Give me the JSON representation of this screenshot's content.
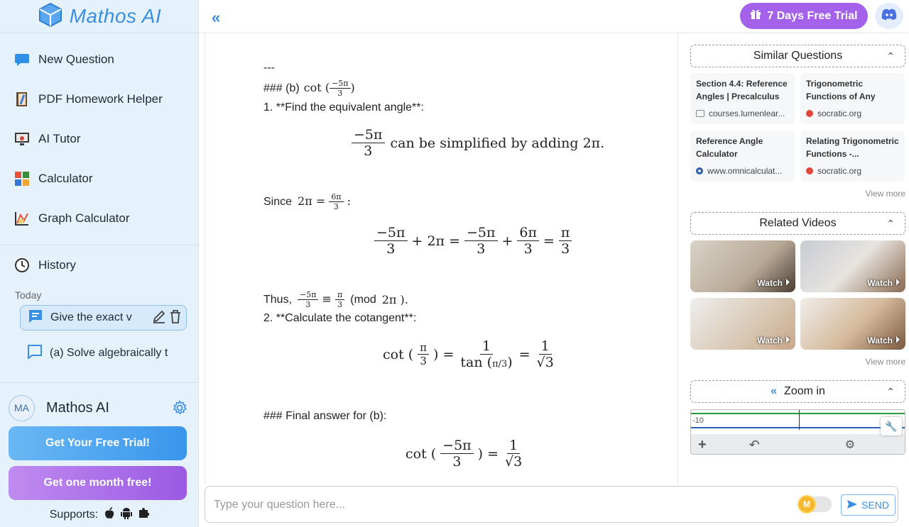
{
  "sidebar": {
    "logo": "Mathos AI",
    "nav": [
      {
        "label": "New Question",
        "icon": "chat-bubble-icon"
      },
      {
        "label": "PDF Homework Helper",
        "icon": "notebook-icon"
      },
      {
        "label": "AI Tutor",
        "icon": "tutor-icon"
      },
      {
        "label": "Calculator",
        "icon": "calculator-icon"
      },
      {
        "label": "Graph Calculator",
        "icon": "graph-icon"
      }
    ],
    "history_label": "History",
    "today_label": "Today",
    "history_items": [
      {
        "label": "Give the exact v"
      },
      {
        "label": "(a) Solve algebraically t"
      }
    ],
    "user": {
      "initials": "MA",
      "name": "Mathos AI"
    },
    "trial_button": "Get Your Free Trial!",
    "month_button": "Get one month free!",
    "supports_label": "Supports:"
  },
  "topbar": {
    "free_trial": "7 Days Free Trial"
  },
  "main": {
    "dashes": "---",
    "b_heading": "### (b)",
    "step1": "1. **Find the equivalent angle**:",
    "simplify_text": "can be simplified by adding 2π.",
    "since": "Since",
    "thus": "Thus,",
    "mod": "(mod",
    "mod_close": "2π ).",
    "step2": "2. **Calculate the cotangent**:",
    "final": "### Final answer for (b):"
  },
  "right": {
    "similar_title": "Similar Questions",
    "similar": [
      {
        "title": "Section 4.4: Reference Angles | Precalculus",
        "source": "courses.lumenlear..."
      },
      {
        "title": "Trigonometric Functions of Any Angl...",
        "source": "socratic.org"
      },
      {
        "title": "Reference Angle Calculator",
        "source": "www.omnicalculat..."
      },
      {
        "title": "Relating Trigonometric Functions -...",
        "source": "socratic.org"
      }
    ],
    "view_more": "View more",
    "videos_title": "Related Videos",
    "watch": "Watch",
    "zoom_title": "Zoom in",
    "graph_tick_label": "-10"
  },
  "input": {
    "placeholder": "Type your question here...",
    "send": "SEND"
  }
}
